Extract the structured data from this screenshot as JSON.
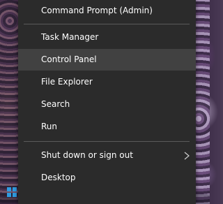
{
  "menu": {
    "items": [
      {
        "label": "Command Prompt (Admin)"
      },
      {
        "label": "Task Manager"
      },
      {
        "label": "Control Panel"
      },
      {
        "label": "File Explorer"
      },
      {
        "label": "Search"
      },
      {
        "label": "Run"
      },
      {
        "label": "Shut down or sign out",
        "submenu_icon": "chevron-right-icon"
      },
      {
        "label": "Desktop"
      }
    ],
    "highlighted_item": "Control Panel",
    "colors": {
      "background": "#2b2b2b",
      "highlight": "#414141",
      "separator": "#5a5a5a",
      "text": "#ffffff"
    }
  },
  "taskbar": {
    "start_icon": "windows-logo-icon"
  }
}
